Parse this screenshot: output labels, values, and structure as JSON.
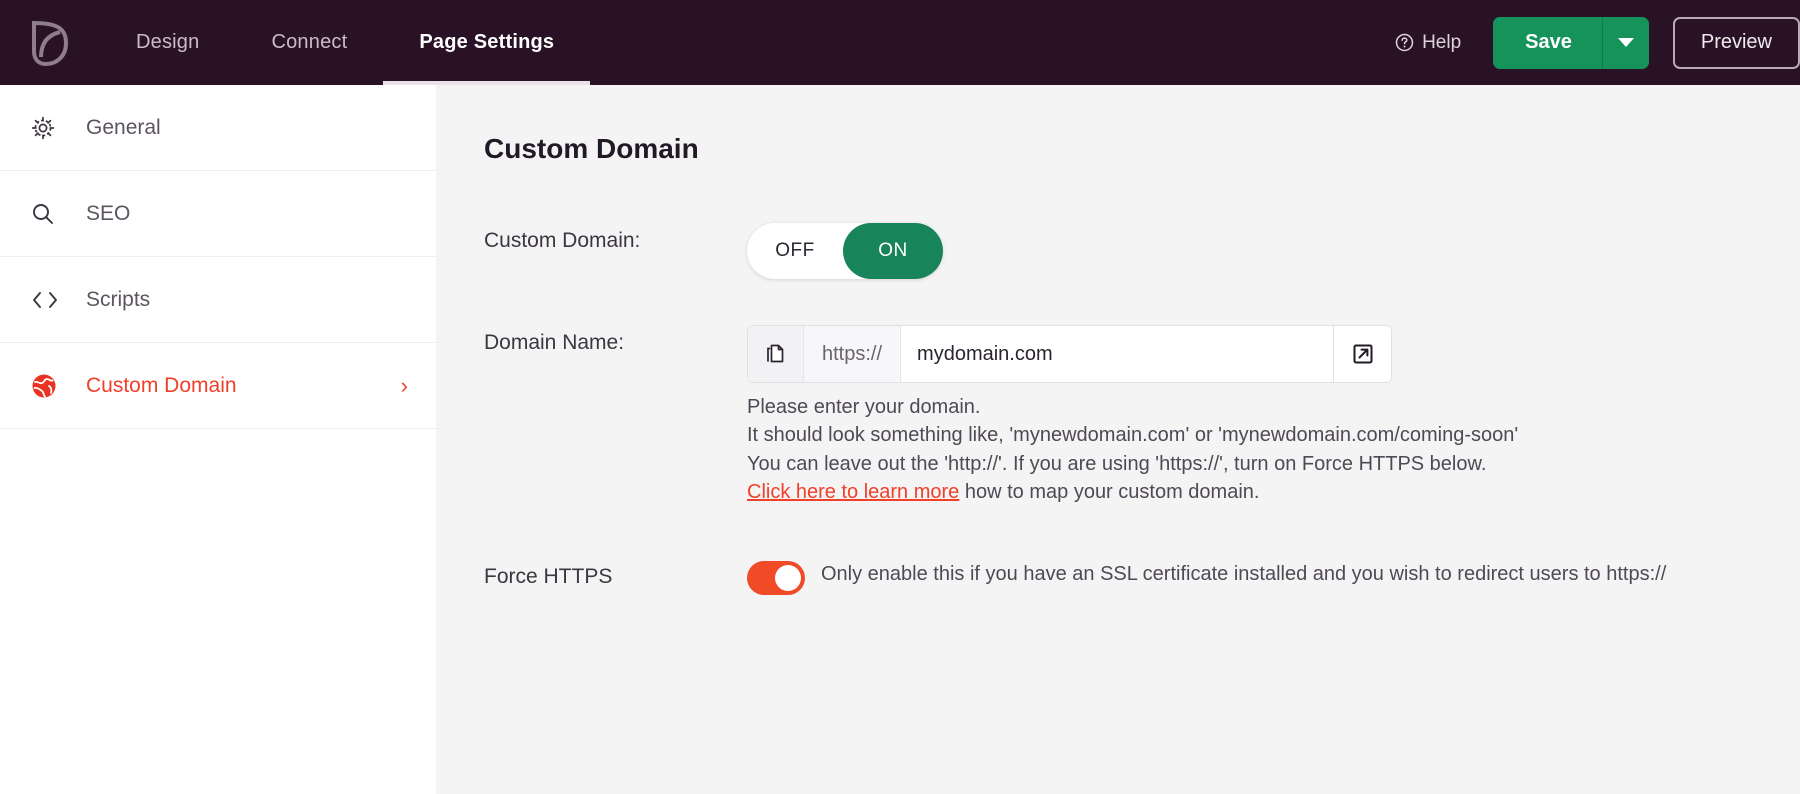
{
  "topbar": {
    "logo_icon": "leaf-logo-icon",
    "nav": [
      {
        "label": "Design",
        "active": false
      },
      {
        "label": "Connect",
        "active": false
      },
      {
        "label": "Page Settings",
        "active": true
      }
    ],
    "help_label": "Help",
    "help_icon": "question-circle-icon",
    "save_label": "Save",
    "save_caret_icon": "chevron-down-icon",
    "preview_label": "Preview",
    "colors": {
      "bar_bg": "#2a1226",
      "save_green": "#16935b",
      "active_underline": "#e9e3e8"
    }
  },
  "sidebar": {
    "items": [
      {
        "label": "General",
        "icon": "gear-icon",
        "active": false,
        "chevron": ""
      },
      {
        "label": "SEO",
        "icon": "search-icon",
        "active": false,
        "chevron": ""
      },
      {
        "label": "Scripts",
        "icon": "code-icon",
        "active": false,
        "chevron": ""
      },
      {
        "label": "Custom Domain",
        "icon": "globe-icon",
        "active": true,
        "chevron": "›"
      }
    ],
    "active_color": "#f0402a"
  },
  "main": {
    "title": "Custom Domain",
    "custom_domain": {
      "label": "Custom Domain:",
      "off_label": "OFF",
      "on_label": "ON",
      "state": "ON",
      "on_color": "#17845a"
    },
    "domain_name": {
      "label": "Domain Name:",
      "copy_icon": "copy-icon",
      "scheme": "https://",
      "value": "mydomain.com",
      "placeholder": "mydomain.com",
      "external_icon": "external-link-icon",
      "help_lines": [
        "Please enter your domain.",
        "It should look something like, 'mynewdomain.com' or 'mynewdomain.com/coming-soon'",
        "You can leave out the 'http://'. If you are using 'https://', turn on Force HTTPS below."
      ],
      "link_text": "Click here to learn more",
      "link_suffix": " how to map your custom domain.",
      "link_color": "#f0402a"
    },
    "force_https": {
      "label": "Force HTTPS",
      "state": "on",
      "switch_color": "#f04a27",
      "description": "Only enable this if you have an SSL certificate installed and you wish to redirect users to https://"
    }
  }
}
